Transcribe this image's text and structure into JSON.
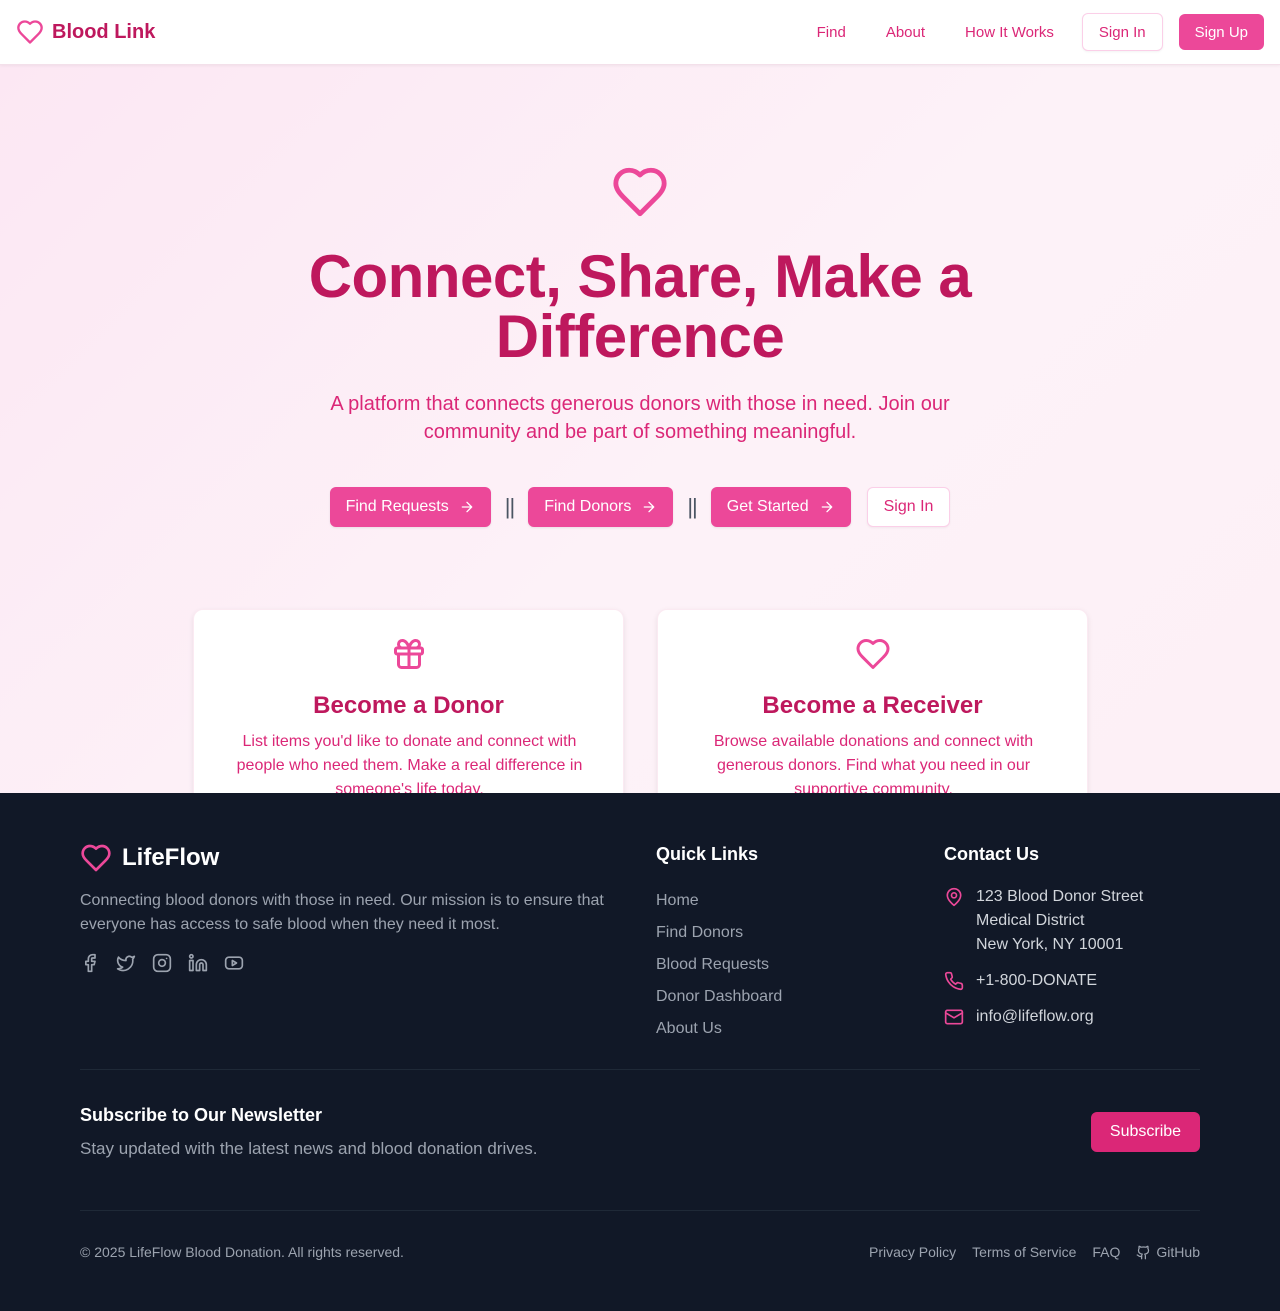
{
  "nav": {
    "brand": "Blood Link",
    "links": [
      "Find",
      "About",
      "How It Works"
    ],
    "sign_in": "Sign In",
    "sign_up": "Sign Up"
  },
  "hero": {
    "title": "Connect, Share, Make a Difference",
    "subtitle": "A platform that connects generous donors with those in need. Join our community and be part of something meaningful.",
    "find_requests": "Find Requests",
    "separator": "||",
    "find_donors": "Find Donors",
    "get_started": "Get Started",
    "sign_in": "Sign In"
  },
  "cards": [
    {
      "title": "Become a Donor",
      "text": "List items you'd like to donate and connect with people who need them. Make a real difference in someone's life today.",
      "icon": "gift-icon"
    },
    {
      "title": "Become a Receiver",
      "text": "Browse available donations and connect with generous donors. Find what you need in our supportive community.",
      "icon": "heart-icon"
    }
  ],
  "footer": {
    "brand": "LifeFlow",
    "description": "Connecting blood donors with those in need. Our mission is to ensure that everyone has access to safe blood when they need it most.",
    "socials": [
      "facebook-icon",
      "twitter-icon",
      "instagram-icon",
      "linkedin-icon",
      "youtube-icon"
    ],
    "quick_links_title": "Quick Links",
    "quick_links": [
      "Home",
      "Find Donors",
      "Blood Requests",
      "Donor Dashboard",
      "About Us"
    ],
    "contact_title": "Contact Us",
    "address_lines": [
      "123 Blood Donor Street",
      "Medical District",
      "New York, NY 10001"
    ],
    "phone": "+1-800-DONATE",
    "email": "info@lifeflow.org",
    "newsletter_title": "Subscribe to Our Newsletter",
    "newsletter_sub": "Stay updated with the latest news and blood donation drives.",
    "subscribe": "Subscribe",
    "copyright": "© 2025 LifeFlow Blood Donation. All rights reserved.",
    "legal": [
      "Privacy Policy",
      "Terms of Service",
      "FAQ"
    ],
    "github": "GitHub"
  },
  "colors": {
    "accent": "#ec4899",
    "accent_dark": "#be185d",
    "footer_bg": "#111827"
  }
}
